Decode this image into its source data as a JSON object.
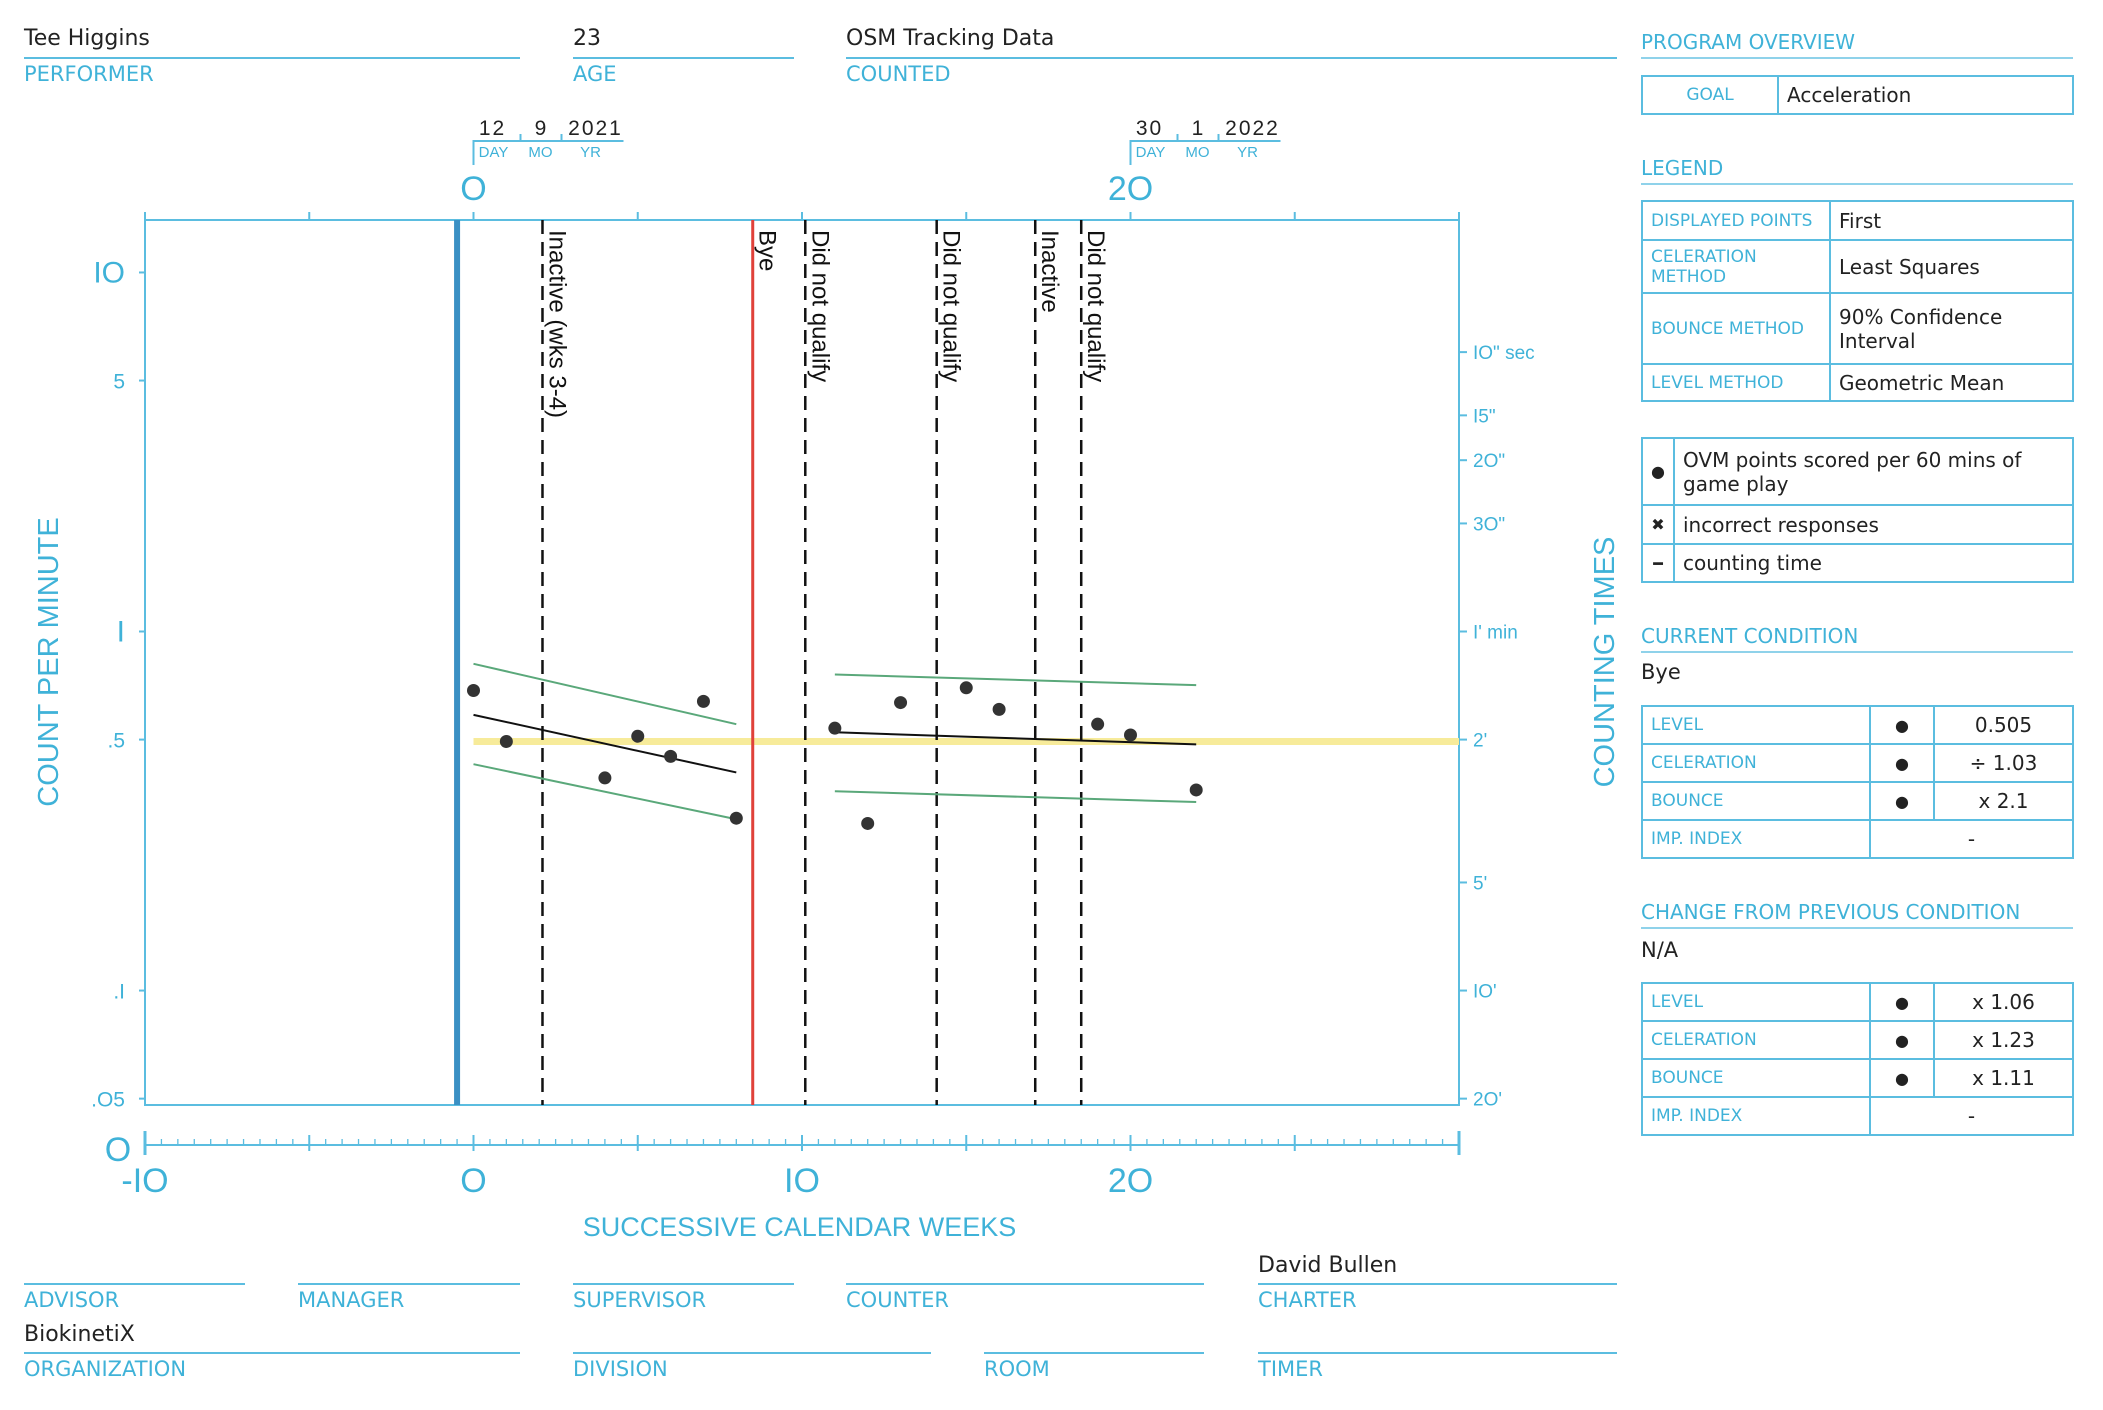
{
  "header": {
    "performer": {
      "value": "Tee Higgins",
      "label": "PERFORMER"
    },
    "age": {
      "value": "23",
      "label": "AGE"
    },
    "counted": {
      "value": "OSM Tracking Data",
      "label": "COUNTED"
    }
  },
  "footer": {
    "advisor": {
      "value": "",
      "label": "ADVISOR"
    },
    "manager": {
      "value": "",
      "label": "MANAGER"
    },
    "supervisor": {
      "value": "",
      "label": "SUPERVISOR"
    },
    "counter": {
      "value": "",
      "label": "COUNTER"
    },
    "charter": {
      "value": "David Bullen",
      "label": "CHARTER"
    },
    "organization": {
      "value": "BiokinetiX",
      "label": "ORGANIZATION"
    },
    "division": {
      "value": "",
      "label": "DIVISION"
    },
    "room": {
      "value": "",
      "label": "ROOM"
    },
    "timer": {
      "value": "",
      "label": "TIMER"
    }
  },
  "panel": {
    "program_overview": {
      "title": "PROGRAM OVERVIEW",
      "goal_label": "GOAL",
      "goal_value": "Acceleration"
    },
    "legend": {
      "title": "LEGEND",
      "rows": [
        {
          "k": "DISPLAYED POINTS",
          "v": "First"
        },
        {
          "k": "CELERATION METHOD",
          "v": "Least Squares"
        },
        {
          "k": "BOUNCE METHOD",
          "v": "90% Confidence Interval"
        },
        {
          "k": "LEVEL METHOD",
          "v": "Geometric Mean"
        }
      ],
      "symbols": [
        {
          "icon": "dot-icon",
          "glyph": "●",
          "text": "OVM points scored per 60 mins of game play"
        },
        {
          "icon": "cross-icon",
          "glyph": "✖",
          "text": "incorrect responses"
        },
        {
          "icon": "dash-icon",
          "glyph": "━",
          "text": "counting time"
        }
      ]
    },
    "current_condition": {
      "title": "CURRENT CONDITION",
      "name": "Bye",
      "rows": [
        {
          "k": "LEVEL",
          "sym": "●",
          "v": "0.505"
        },
        {
          "k": "CELERATION",
          "sym": "●",
          "v": "÷ 1.03"
        },
        {
          "k": "BOUNCE",
          "sym": "●",
          "v": "x 2.1"
        },
        {
          "k": "IMP. INDEX",
          "v": "-"
        }
      ]
    },
    "change": {
      "title": "CHANGE FROM PREVIOUS CONDITION",
      "name": "N/A",
      "rows": [
        {
          "k": "LEVEL",
          "sym": "●",
          "v": "x 1.06"
        },
        {
          "k": "CELERATION",
          "sym": "●",
          "v": "x 1.23"
        },
        {
          "k": "BOUNCE",
          "sym": "●",
          "v": "x 1.11"
        },
        {
          "k": "IMP. INDEX",
          "v": "-"
        }
      ]
    }
  },
  "chart_data": {
    "type": "scatter",
    "yscale": "log",
    "xlabel": "SUCCESSIVE CALENDAR WEEKS",
    "ylabel": "COUNT PER MINUTE",
    "y2label": "COUNTING TIMES",
    "xlim": [
      -10,
      30
    ],
    "ylim": [
      0.048,
      14
    ],
    "x_ticks": [
      {
        "v": -10,
        "t": "-IO"
      },
      {
        "v": 0,
        "t": "O"
      },
      {
        "v": 10,
        "t": "IO"
      },
      {
        "v": 20,
        "t": "2O"
      }
    ],
    "x_origin_label": "O",
    "top_ticks": [
      {
        "v": 0,
        "t": "O"
      },
      {
        "v": 20,
        "t": "2O"
      }
    ],
    "top_dates": [
      {
        "week": 0,
        "day": "12",
        "mo": "9",
        "yr": "2021"
      },
      {
        "week": 20,
        "day": "30",
        "mo": "1",
        "yr": "2022"
      }
    ],
    "date_labels": {
      "day": "DAY",
      "mo": "MO",
      "yr": "YR"
    },
    "y_ticks": [
      {
        "v": 10,
        "t": "IO"
      },
      {
        "v": 5,
        "t": "5"
      },
      {
        "v": 1,
        "t": "I"
      },
      {
        "v": 0.5,
        "t": ".5"
      },
      {
        "v": 0.1,
        "t": ".I"
      },
      {
        "v": 0.05,
        "t": ".O5"
      }
    ],
    "y2_ticks": [
      {
        "v": 6,
        "t": "IO\" sec"
      },
      {
        "v": 4,
        "t": "I5\""
      },
      {
        "v": 3,
        "t": "2O\""
      },
      {
        "v": 2,
        "t": "3O\""
      },
      {
        "v": 1,
        "t": "I' min"
      },
      {
        "v": 0.5,
        "t": "2'"
      },
      {
        "v": 0.2,
        "t": "5'"
      },
      {
        "v": 0.1,
        "t": "IO'"
      },
      {
        "v": 0.05,
        "t": "2O'"
      }
    ],
    "points": [
      {
        "x": 0,
        "y": 0.685
      },
      {
        "x": 1,
        "y": 0.494
      },
      {
        "x": 4,
        "y": 0.391
      },
      {
        "x": 5,
        "y": 0.511
      },
      {
        "x": 6,
        "y": 0.449
      },
      {
        "x": 7,
        "y": 0.639
      },
      {
        "x": 8,
        "y": 0.302
      },
      {
        "x": 11,
        "y": 0.538
      },
      {
        "x": 12,
        "y": 0.292
      },
      {
        "x": 13,
        "y": 0.634
      },
      {
        "x": 15,
        "y": 0.697
      },
      {
        "x": 16,
        "y": 0.607
      },
      {
        "x": 19,
        "y": 0.552
      },
      {
        "x": 20,
        "y": 0.515
      },
      {
        "x": 22,
        "y": 0.362
      }
    ],
    "celeration_lines": [
      {
        "kind": "celeration",
        "x": [
          0,
          8
        ],
        "y": [
          0.586,
          0.405
        ],
        "color": "#111111"
      },
      {
        "kind": "bounce-upper",
        "x": [
          0,
          8
        ],
        "y": [
          0.813,
          0.552
        ],
        "color": "#5aa87a"
      },
      {
        "kind": "bounce-lower",
        "x": [
          0,
          8
        ],
        "y": [
          0.427,
          0.3
        ],
        "color": "#5aa87a"
      },
      {
        "kind": "celeration",
        "x": [
          11,
          22
        ],
        "y": [
          0.524,
          0.485
        ],
        "color": "#111111"
      },
      {
        "kind": "bounce-upper",
        "x": [
          11,
          22
        ],
        "y": [
          0.759,
          0.709
        ],
        "color": "#5aa87a"
      },
      {
        "kind": "bounce-lower",
        "x": [
          11,
          22
        ],
        "y": [
          0.359,
          0.335
        ],
        "color": "#5aa87a"
      }
    ],
    "aim_line": {
      "x": [
        0,
        30
      ],
      "y": 0.494,
      "color": "#f7eb9a"
    },
    "start_line": {
      "x": -0.5,
      "color": "#3a90c4"
    },
    "phase_lines": [
      {
        "x": 2.1,
        "label": "Inactive (wks 3-4)",
        "style": "dashed",
        "color": "#111111"
      },
      {
        "x": 8.5,
        "label": "Bye",
        "style": "solid",
        "color": "#e0413a"
      },
      {
        "x": 10.1,
        "label": "Did not qualify",
        "style": "dashed",
        "color": "#111111"
      },
      {
        "x": 14.1,
        "label": "Did not qualify",
        "style": "dashed",
        "color": "#111111"
      },
      {
        "x": 17.1,
        "label": "Inactive",
        "style": "dashed",
        "color": "#111111"
      },
      {
        "x": 18.5,
        "label": "Did not qualify",
        "style": "dashed",
        "color": "#111111"
      }
    ],
    "colors": {
      "axis": "#5bbde0",
      "axis_text": "#3fb2d8",
      "point": "#333333"
    }
  }
}
